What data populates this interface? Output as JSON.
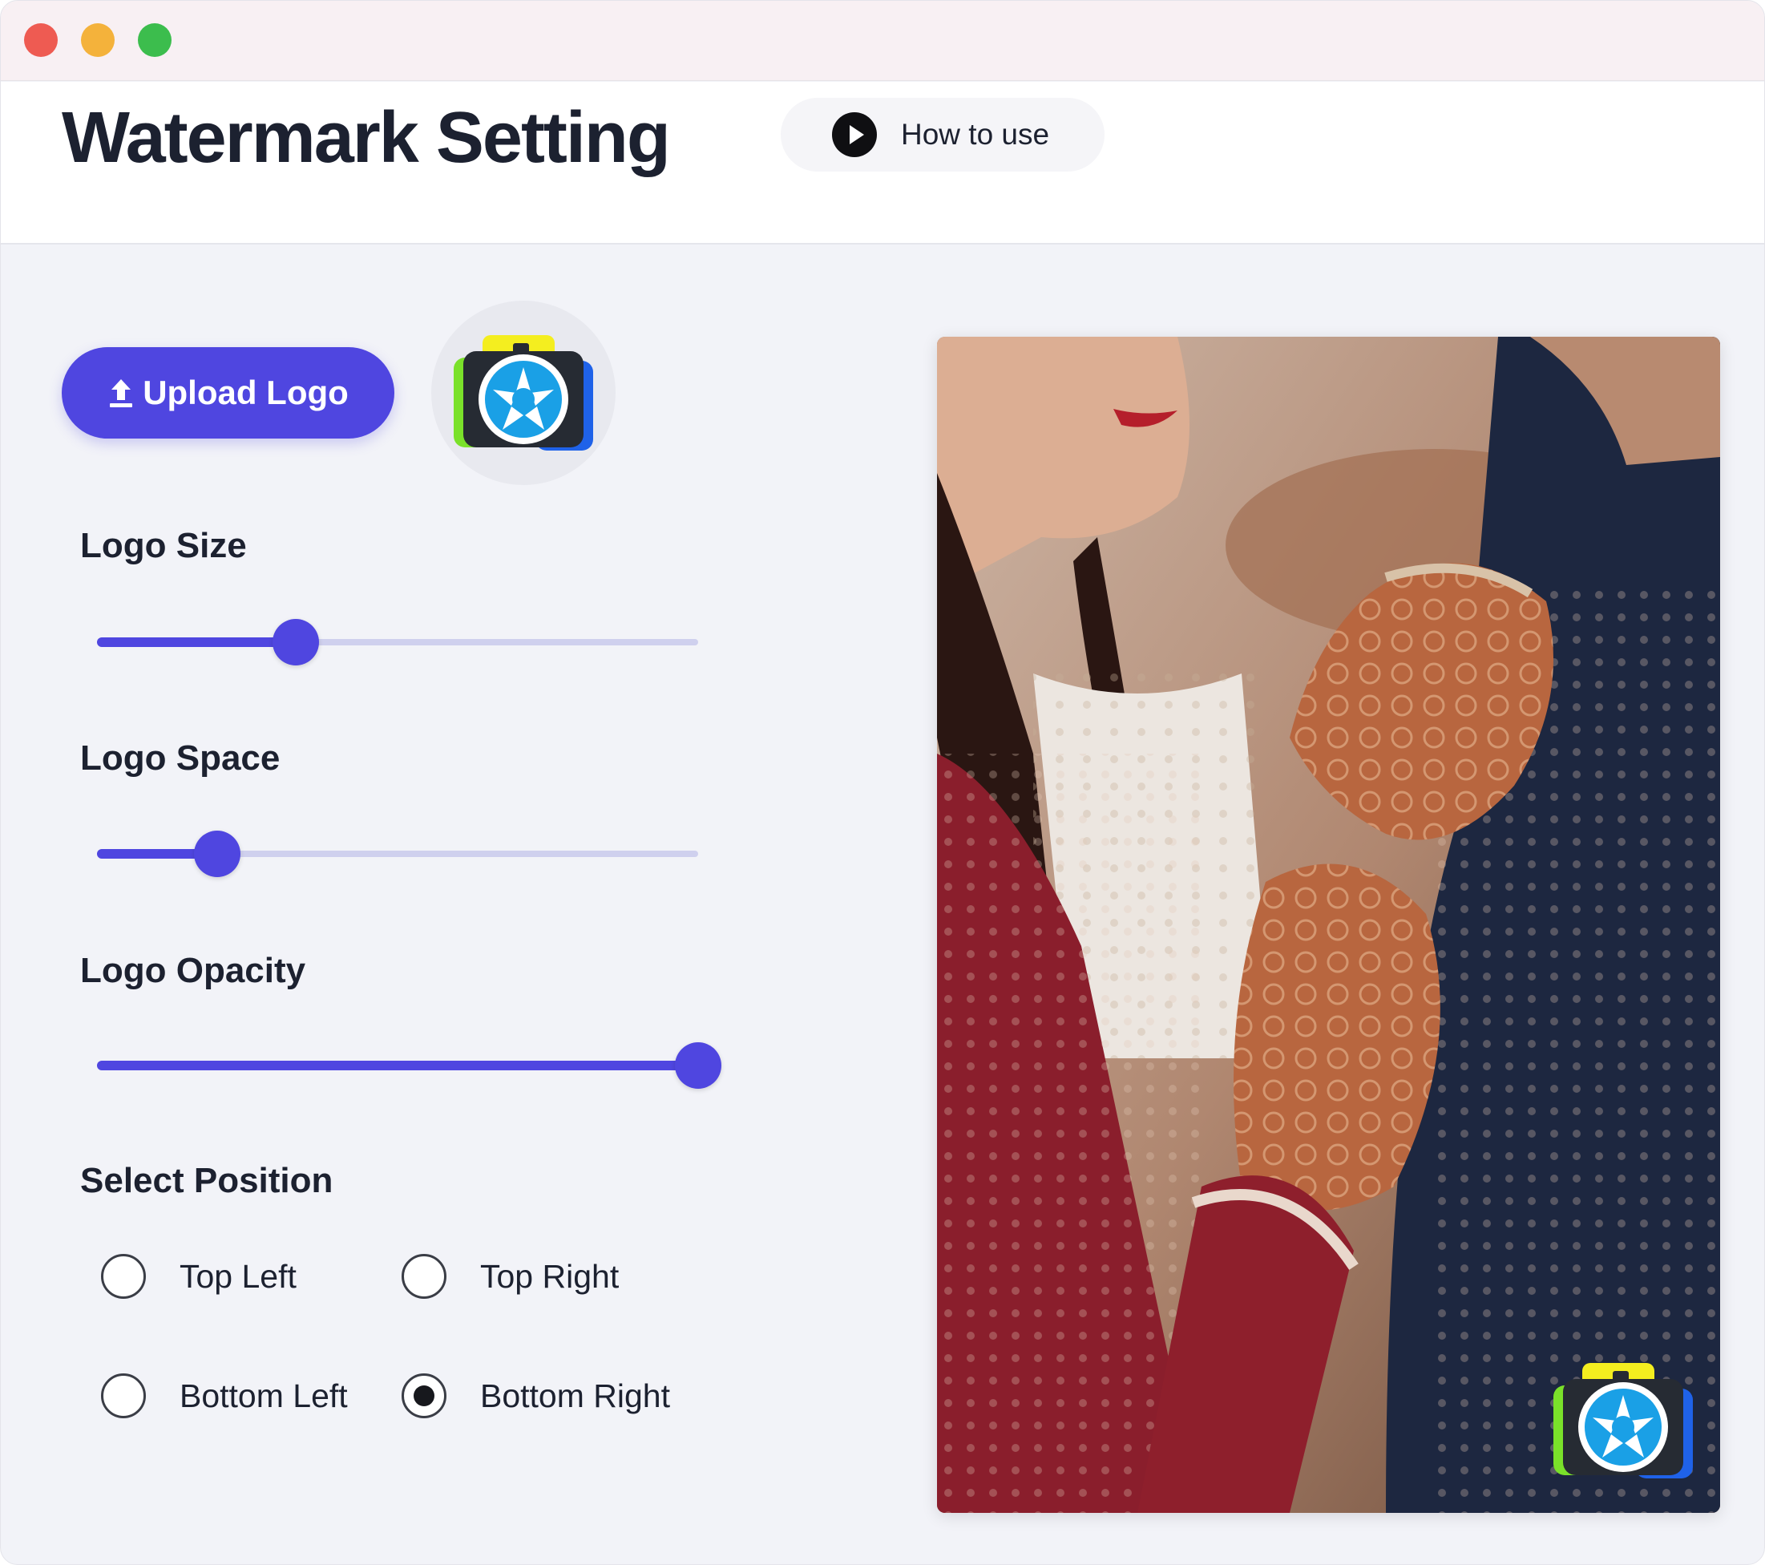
{
  "window": {
    "controls": [
      "close",
      "minimize",
      "zoom"
    ]
  },
  "header": {
    "title": "Watermark Setting",
    "how_to_use_label": "How to use",
    "how_to_use_icon": "play-icon"
  },
  "upload": {
    "label": "Upload Logo",
    "icon": "upload-icon"
  },
  "logo_preview": {
    "icon": "camera-logo-icon"
  },
  "controls": {
    "logo_size": {
      "label": "Logo Size",
      "value": 0.33
    },
    "logo_space": {
      "label": "Logo Space",
      "value": 0.2
    },
    "logo_opacity": {
      "label": "Logo Opacity",
      "value": 1.0
    }
  },
  "position": {
    "label": "Select Position",
    "options": [
      {
        "label": "Top Left",
        "checked": false
      },
      {
        "label": "Top Right",
        "checked": false
      },
      {
        "label": "Bottom Left",
        "checked": false
      },
      {
        "label": "Bottom Right",
        "checked": true
      }
    ]
  },
  "preview": {
    "watermark_icon": "camera-logo-icon"
  },
  "colors": {
    "accent": "#4f46e0",
    "track": "#cfd0ee",
    "background": "#f2f3f8"
  }
}
